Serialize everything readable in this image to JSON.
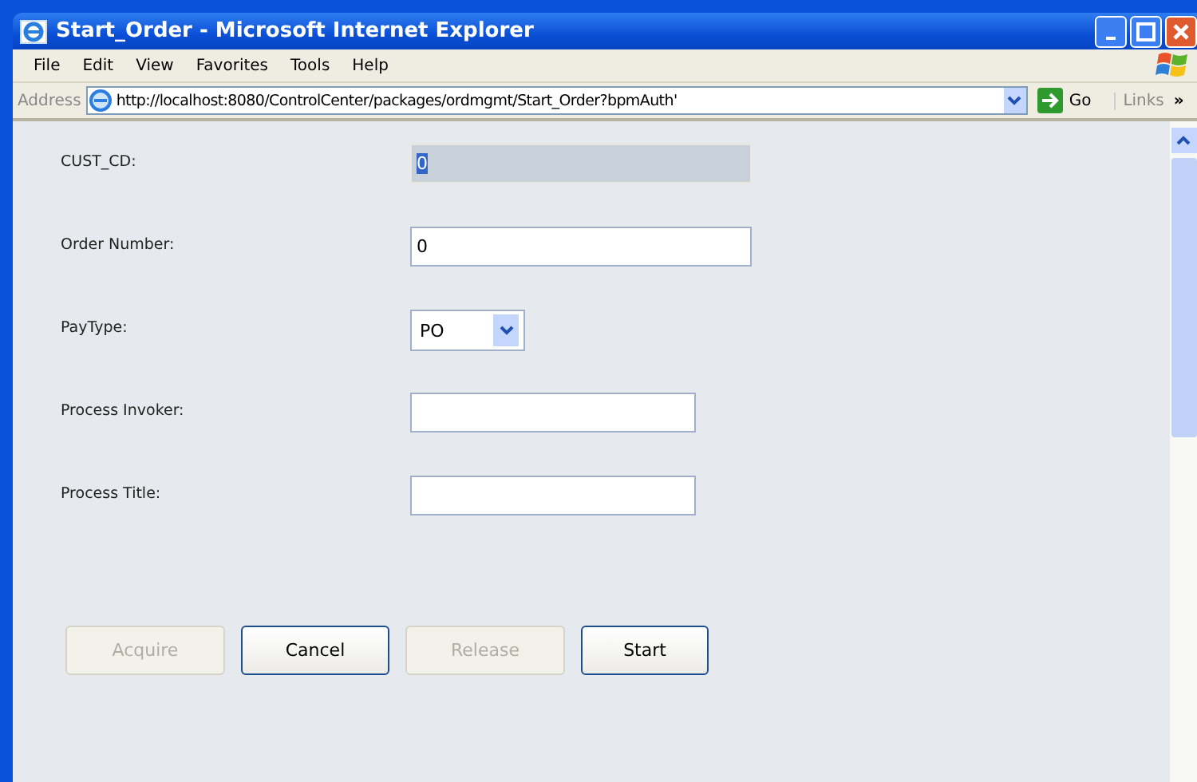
{
  "window": {
    "title": "Start_Order - Microsoft Internet Explorer"
  },
  "menu": [
    "File",
    "Edit",
    "View",
    "Favorites",
    "Tools",
    "Help"
  ],
  "address_bar": {
    "label": "Address",
    "url": "http://localhost:8080/ControlCenter/packages/ordmgmt/Start_Order?bpmAuth'",
    "go": "Go",
    "links": "Links",
    "more": "»"
  },
  "fields": [
    {
      "label": "CUST_CD:",
      "kind": "text",
      "value": "0",
      "disabled": true,
      "value_selected": true,
      "wide": true
    },
    {
      "label": "Order Number:",
      "kind": "text",
      "value": "0",
      "disabled": false,
      "value_selected": false,
      "wide": true
    },
    {
      "label": "PayType:",
      "kind": "select",
      "value": "PO",
      "disabled": false
    },
    {
      "label": "Process Invoker:",
      "kind": "text",
      "disabled": false,
      "wide": false
    },
    {
      "label": "Process Title:",
      "kind": "text",
      "disabled": false,
      "wide": false
    }
  ],
  "buttons": [
    {
      "label": "Acquire",
      "disabled": true
    },
    {
      "label": "Cancel",
      "disabled": false
    },
    {
      "label": "Release",
      "disabled": true
    },
    {
      "label": "Start",
      "disabled": false
    }
  ]
}
